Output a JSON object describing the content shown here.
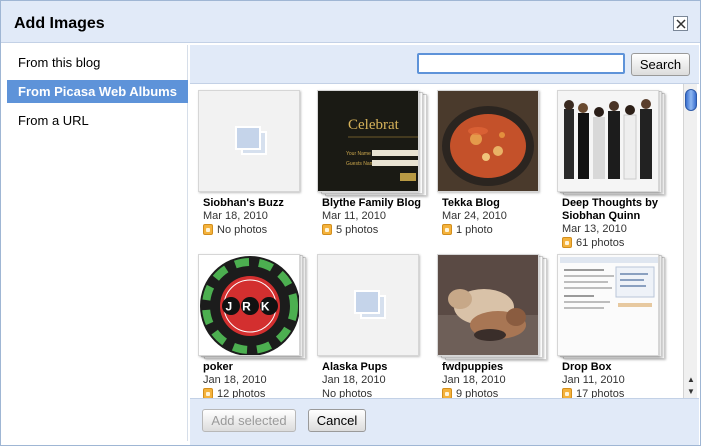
{
  "dialog": {
    "title": "Add Images"
  },
  "sidebar": {
    "items": [
      {
        "label": "From this blog",
        "active": false
      },
      {
        "label": "From Picasa Web Albums",
        "active": true
      },
      {
        "label": "From a URL",
        "active": false
      }
    ]
  },
  "search": {
    "value": "",
    "button_label": "Search"
  },
  "albums": [
    {
      "name": "Siobhan's Buzz",
      "date": "Mar 18, 2010",
      "count": "No photos",
      "locked": true,
      "has_cover": false
    },
    {
      "name": "Blythe Family Blog",
      "date": "Mar 11, 2010",
      "count": "5 photos",
      "locked": true,
      "has_cover": true,
      "cover_text": "Celebrat",
      "cover_fields": [
        "Your Name",
        "Guests Name"
      ]
    },
    {
      "name": "Tekka Blog",
      "date": "Mar 24, 2010",
      "count": "1 photo",
      "locked": true,
      "has_cover": true
    },
    {
      "name": "Deep Thoughts by Siobhan Quinn",
      "date": "Mar 13, 2010",
      "count": "61 photos",
      "locked": true,
      "has_cover": true
    },
    {
      "name": "poker",
      "date": "Jan 18, 2010",
      "count": "12 photos",
      "locked": true,
      "has_cover": true,
      "cover_text": "JRK"
    },
    {
      "name": "Alaska Pups",
      "date": "Jan 18, 2010",
      "count": "No photos",
      "locked": false,
      "has_cover": false
    },
    {
      "name": "fwdpuppies",
      "date": "Jan 18, 2010",
      "count": "9 photos",
      "locked": true,
      "has_cover": true
    },
    {
      "name": "Drop Box",
      "date": "Jan 11, 2010",
      "count": "17 photos",
      "locked": true,
      "has_cover": true
    }
  ],
  "footer": {
    "add_selected_label": "Add selected",
    "cancel_label": "Cancel"
  },
  "colors": {
    "accent": "#5e93d9",
    "header_bg": "#e1eaf8",
    "lock": "#f4b23c"
  }
}
